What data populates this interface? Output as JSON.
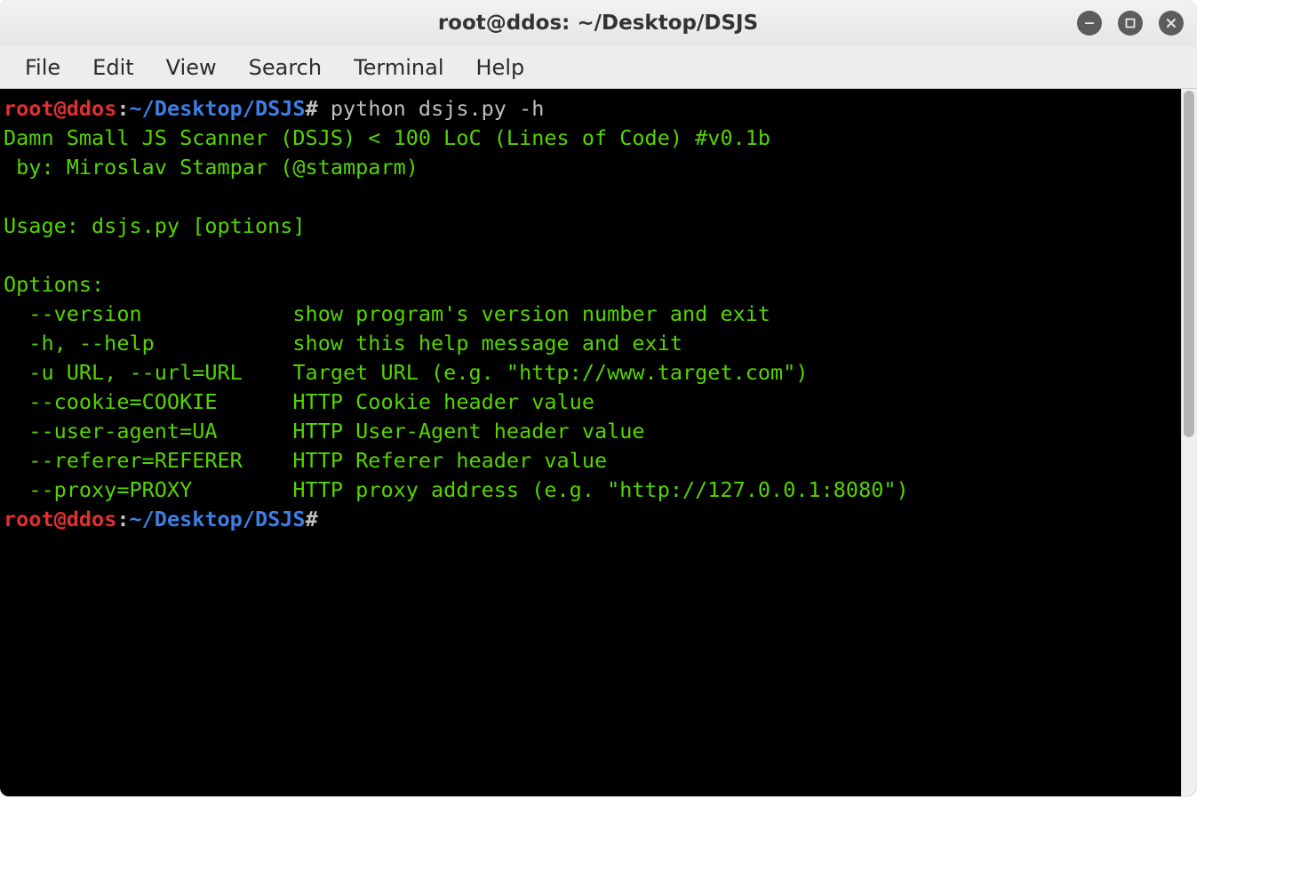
{
  "window": {
    "title": "root@ddos: ~/Desktop/DSJS"
  },
  "menubar": {
    "items": [
      "File",
      "Edit",
      "View",
      "Search",
      "Terminal",
      "Help"
    ]
  },
  "prompt": {
    "user": "root",
    "at": "@",
    "host": "ddos",
    "colon": ":",
    "path": "~/Desktop/DSJS",
    "symbol": "#"
  },
  "session": {
    "command1": " python dsjs.py -h",
    "out_line1": "Damn Small JS Scanner (DSJS) < 100 LoC (Lines of Code) #v0.1b",
    "out_line2": " by: Miroslav Stampar (@stamparm)",
    "blank": "",
    "out_line3": "Usage: dsjs.py [options]",
    "out_line4": "Options:",
    "opt_version": "  --version            show program's version number and exit",
    "opt_help": "  -h, --help           show this help message and exit",
    "opt_url": "  -u URL, --url=URL    Target URL (e.g. \"http://www.target.com\")",
    "opt_cookie": "  --cookie=COOKIE      HTTP Cookie header value",
    "opt_ua": "  --user-agent=UA      HTTP User-Agent header value",
    "opt_referer": "  --referer=REFERER    HTTP Referer header value",
    "opt_proxy": "  --proxy=PROXY        HTTP proxy address (e.g. \"http://127.0.0.1:8080\")",
    "command2": " "
  },
  "colors": {
    "prompt_user": "#e03030",
    "prompt_path": "#3d7fe6",
    "prompt_sep": "#bfbfbf",
    "output": "#55d400",
    "command": "#bfbfbf",
    "terminal_bg": "#000000",
    "chrome_bg": "#e8e8e7"
  }
}
